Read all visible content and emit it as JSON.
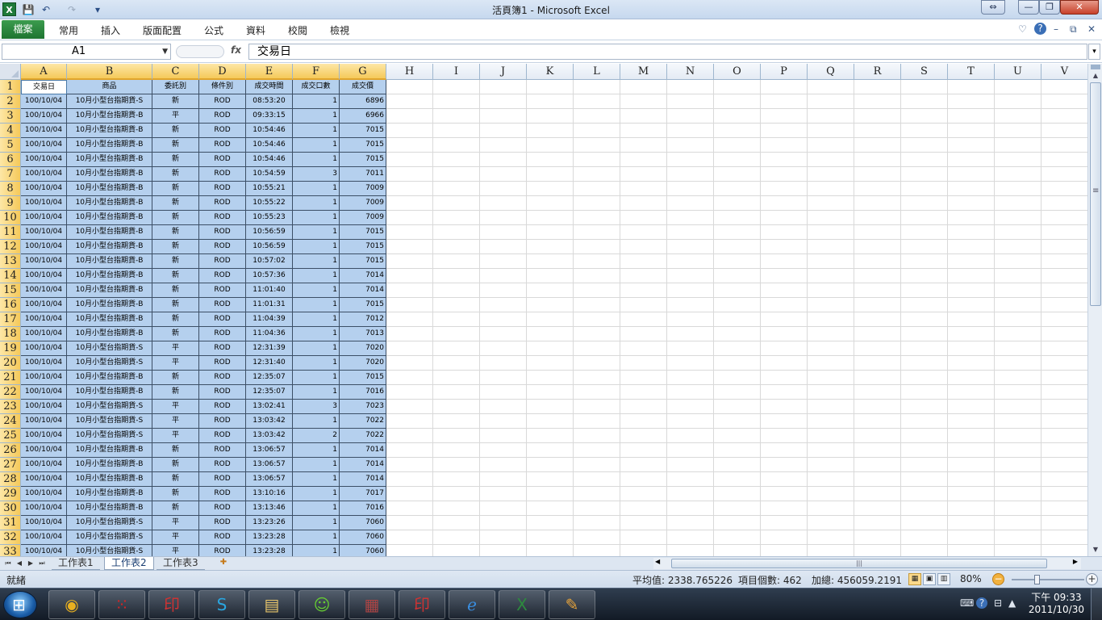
{
  "window": {
    "title": "活頁簿1 - Microsoft Excel",
    "app_icon": "X",
    "qat": {
      "save_icon": "💾",
      "undo_icon": "↶",
      "redo_icon": "↷",
      "customize_icon": "▾"
    },
    "buttons": {
      "restore_down": "⇔",
      "minimize": "—",
      "maximize": "❐",
      "close": "✕"
    }
  },
  "ribbon": {
    "file_tab": "檔案",
    "tabs": [
      "常用",
      "插入",
      "版面配置",
      "公式",
      "資料",
      "校閱",
      "檢視"
    ],
    "right_icons": {
      "minimize_ribbon": "♡",
      "help": "?",
      "min": "–",
      "restore": "⧉",
      "close": "✕"
    }
  },
  "formula_bar": {
    "name_box": "A1",
    "fx_label": "fx",
    "content": "交易日"
  },
  "columns": [
    "A",
    "B",
    "C",
    "D",
    "E",
    "F",
    "G",
    "H",
    "I",
    "J",
    "K",
    "L",
    "M",
    "N",
    "O",
    "P",
    "Q",
    "R",
    "S",
    "T",
    "U",
    "V"
  ],
  "table": {
    "headers": [
      "交易日",
      "商品",
      "委託別",
      "條件別",
      "成交時間",
      "成交口數",
      "成交價"
    ],
    "rows": [
      [
        "100/10/04",
        "10月小型台指期貨-S",
        "新",
        "ROD",
        "08:53:20",
        "1",
        "6896"
      ],
      [
        "100/10/04",
        "10月小型台指期貨-B",
        "平",
        "ROD",
        "09:33:15",
        "1",
        "6966"
      ],
      [
        "100/10/04",
        "10月小型台指期貨-B",
        "新",
        "ROD",
        "10:54:46",
        "1",
        "7015"
      ],
      [
        "100/10/04",
        "10月小型台指期貨-B",
        "新",
        "ROD",
        "10:54:46",
        "1",
        "7015"
      ],
      [
        "100/10/04",
        "10月小型台指期貨-B",
        "新",
        "ROD",
        "10:54:46",
        "1",
        "7015"
      ],
      [
        "100/10/04",
        "10月小型台指期貨-B",
        "新",
        "ROD",
        "10:54:59",
        "3",
        "7011"
      ],
      [
        "100/10/04",
        "10月小型台指期貨-B",
        "新",
        "ROD",
        "10:55:21",
        "1",
        "7009"
      ],
      [
        "100/10/04",
        "10月小型台指期貨-B",
        "新",
        "ROD",
        "10:55:22",
        "1",
        "7009"
      ],
      [
        "100/10/04",
        "10月小型台指期貨-B",
        "新",
        "ROD",
        "10:55:23",
        "1",
        "7009"
      ],
      [
        "100/10/04",
        "10月小型台指期貨-B",
        "新",
        "ROD",
        "10:56:59",
        "1",
        "7015"
      ],
      [
        "100/10/04",
        "10月小型台指期貨-B",
        "新",
        "ROD",
        "10:56:59",
        "1",
        "7015"
      ],
      [
        "100/10/04",
        "10月小型台指期貨-B",
        "新",
        "ROD",
        "10:57:02",
        "1",
        "7015"
      ],
      [
        "100/10/04",
        "10月小型台指期貨-B",
        "新",
        "ROD",
        "10:57:36",
        "1",
        "7014"
      ],
      [
        "100/10/04",
        "10月小型台指期貨-B",
        "新",
        "ROD",
        "11:01:40",
        "1",
        "7014"
      ],
      [
        "100/10/04",
        "10月小型台指期貨-B",
        "新",
        "ROD",
        "11:01:31",
        "1",
        "7015"
      ],
      [
        "100/10/04",
        "10月小型台指期貨-B",
        "新",
        "ROD",
        "11:04:39",
        "1",
        "7012"
      ],
      [
        "100/10/04",
        "10月小型台指期貨-B",
        "新",
        "ROD",
        "11:04:36",
        "1",
        "7013"
      ],
      [
        "100/10/04",
        "10月小型台指期貨-S",
        "平",
        "ROD",
        "12:31:39",
        "1",
        "7020"
      ],
      [
        "100/10/04",
        "10月小型台指期貨-S",
        "平",
        "ROD",
        "12:31:40",
        "1",
        "7020"
      ],
      [
        "100/10/04",
        "10月小型台指期貨-B",
        "新",
        "ROD",
        "12:35:07",
        "1",
        "7015"
      ],
      [
        "100/10/04",
        "10月小型台指期貨-B",
        "新",
        "ROD",
        "12:35:07",
        "1",
        "7016"
      ],
      [
        "100/10/04",
        "10月小型台指期貨-S",
        "平",
        "ROD",
        "13:02:41",
        "3",
        "7023"
      ],
      [
        "100/10/04",
        "10月小型台指期貨-S",
        "平",
        "ROD",
        "13:03:42",
        "1",
        "7022"
      ],
      [
        "100/10/04",
        "10月小型台指期貨-S",
        "平",
        "ROD",
        "13:03:42",
        "2",
        "7022"
      ],
      [
        "100/10/04",
        "10月小型台指期貨-B",
        "新",
        "ROD",
        "13:06:57",
        "1",
        "7014"
      ],
      [
        "100/10/04",
        "10月小型台指期貨-B",
        "新",
        "ROD",
        "13:06:57",
        "1",
        "7014"
      ],
      [
        "100/10/04",
        "10月小型台指期貨-B",
        "新",
        "ROD",
        "13:06:57",
        "1",
        "7014"
      ],
      [
        "100/10/04",
        "10月小型台指期貨-B",
        "新",
        "ROD",
        "13:10:16",
        "1",
        "7017"
      ],
      [
        "100/10/04",
        "10月小型台指期貨-B",
        "新",
        "ROD",
        "13:13:46",
        "1",
        "7016"
      ],
      [
        "100/10/04",
        "10月小型台指期貨-S",
        "平",
        "ROD",
        "13:23:26",
        "1",
        "7060"
      ],
      [
        "100/10/04",
        "10月小型台指期貨-S",
        "平",
        "ROD",
        "13:23:28",
        "1",
        "7060"
      ],
      [
        "100/10/04",
        "10月小型台指期貨-S",
        "平",
        "ROD",
        "13:23:28",
        "1",
        "7060"
      ]
    ]
  },
  "sheets": {
    "tabs": [
      "工作表1",
      "工作表2",
      "工作表3"
    ],
    "active": "工作表2",
    "nav": [
      "⏮",
      "◀",
      "▶",
      "⏭"
    ]
  },
  "status": {
    "ready": "就緒",
    "average": "平均值: 2338.765226",
    "count": "項目個數: 462",
    "sum": "加總: 456059.2191",
    "zoom": "80%",
    "zoom_level": 0.8
  },
  "taskbar": {
    "apps": [
      {
        "name": "chrome",
        "glyph": "◉",
        "color": "#e8b020"
      },
      {
        "name": "app-red",
        "glyph": "⁙",
        "color": "#d22"
      },
      {
        "name": "app-stamp-1",
        "glyph": "印",
        "color": "#c33"
      },
      {
        "name": "skype",
        "glyph": "S",
        "color": "#2aa6e0"
      },
      {
        "name": "file-explorer",
        "glyph": "▤",
        "color": "#e6c46a"
      },
      {
        "name": "messenger",
        "glyph": "☺",
        "color": "#6c3"
      },
      {
        "name": "winrar",
        "glyph": "▦",
        "color": "#a44"
      },
      {
        "name": "app-stamp-2",
        "glyph": "印",
        "color": "#c33"
      },
      {
        "name": "internet-explorer",
        "glyph": "ℯ",
        "color": "#3a8ee0"
      },
      {
        "name": "excel",
        "glyph": "X",
        "color": "#2d8a3e"
      },
      {
        "name": "paint",
        "glyph": "✎",
        "color": "#e9a43a"
      }
    ],
    "clock_time": "下午 09:33",
    "clock_date": "2011/10/30"
  },
  "colors": {
    "selection": "#b5d0ee",
    "row_header": "#f5c95a",
    "accent": "#1e7431"
  }
}
